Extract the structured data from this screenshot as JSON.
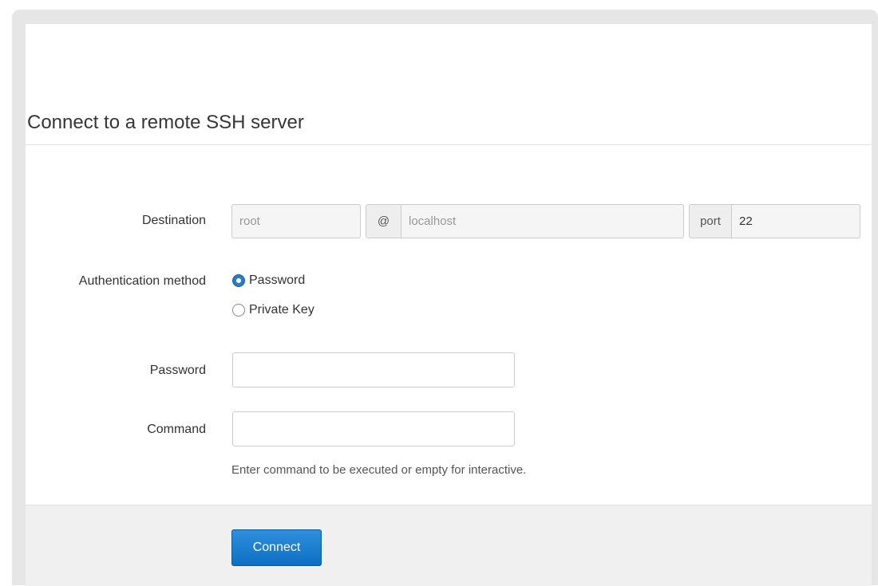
{
  "dialog": {
    "title": "Connect to a remote SSH server"
  },
  "destination": {
    "label": "Destination",
    "user_placeholder": "root",
    "at_symbol": "@",
    "host_placeholder": "localhost",
    "port_label": "port",
    "port_value": "22"
  },
  "auth": {
    "label": "Authentication method",
    "options": [
      {
        "label": "Password",
        "selected": true
      },
      {
        "label": "Private Key",
        "selected": false
      }
    ]
  },
  "password": {
    "label": "Password",
    "value": ""
  },
  "command": {
    "label": "Command",
    "value": "",
    "help": "Enter command to be executed or empty for interactive."
  },
  "footer": {
    "connect_label": "Connect"
  },
  "colors": {
    "primary": "#2b7cc7",
    "frame": "#e6e6e6",
    "footer": "#f0f0f0"
  }
}
